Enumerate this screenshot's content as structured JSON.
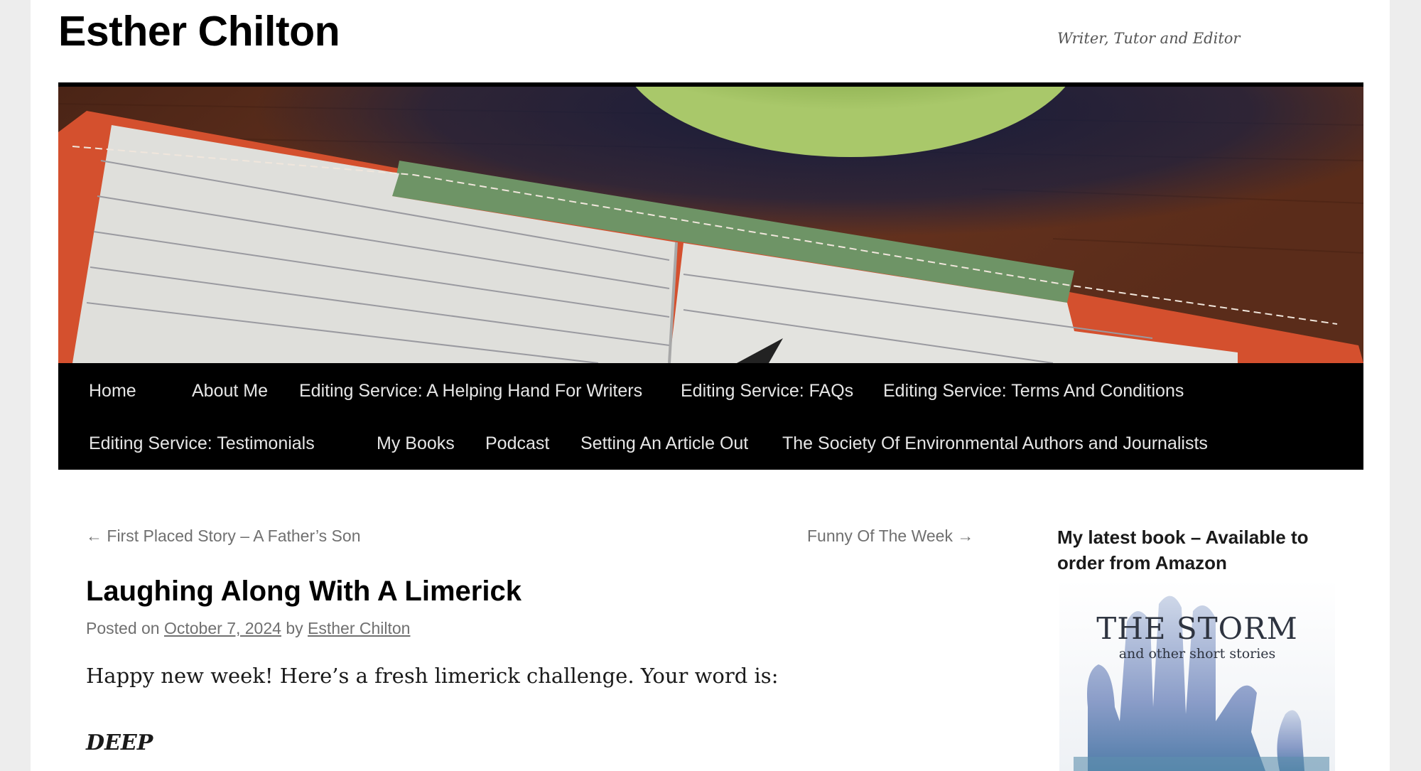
{
  "site": {
    "title": "Esther Chilton",
    "tagline": "Writer, Tutor and Editor"
  },
  "header_image": {
    "description_icon": "notebook-header-image",
    "colors": {
      "wood": "#5a2f1c",
      "notebook_cover": "#d9502f",
      "paper": "#dcdcd8",
      "ribbon": "#6f9a6a",
      "bowl": "#8bb04a"
    }
  },
  "nav": {
    "row1": [
      "Home",
      "About Me",
      "Editing Service: A Helping Hand For Writers",
      "Editing Service: FAQs",
      "Editing Service: Terms And Conditions"
    ],
    "row2": [
      "Editing Service: Testimonials",
      "My Books",
      "Podcast",
      "Setting An Article Out",
      "The Society Of Environmental Authors and Journalists"
    ]
  },
  "post_nav": {
    "previous": "← First Placed Story – A Father’s Son",
    "next": "Funny Of The Week →"
  },
  "post": {
    "title": "Laughing Along With A Limerick",
    "meta_prefix": "Posted on",
    "date": "October 7, 2024",
    "meta_by": "by",
    "author": "Esther Chilton",
    "intro": "Happy new week! Here’s a fresh limerick challenge. Your word is:",
    "word": "DEEP"
  },
  "sidebar": {
    "widget_title": "My latest book – Available to order from Amazon",
    "book": {
      "title": "THE STORM",
      "subtitle": "and other short stories"
    }
  }
}
